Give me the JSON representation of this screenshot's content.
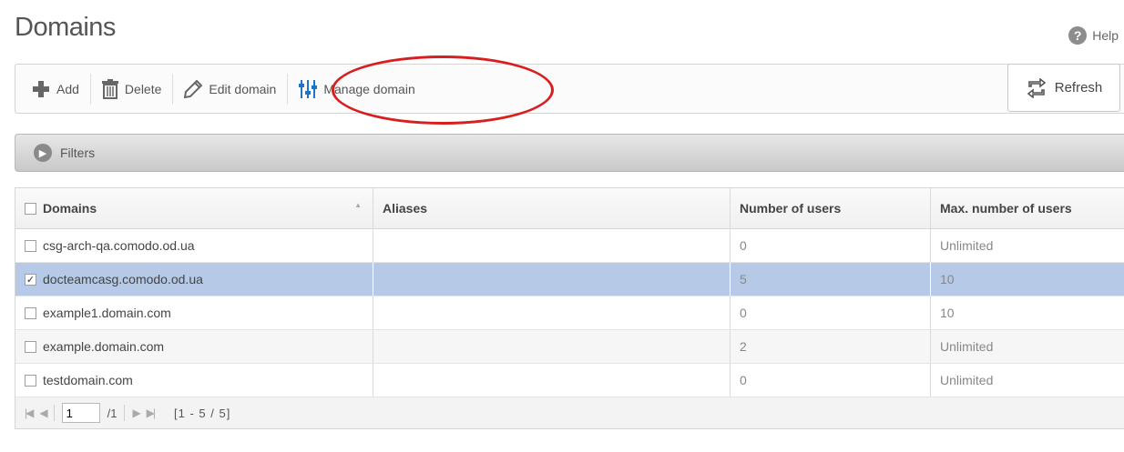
{
  "page": {
    "title": "Domains",
    "help_label": "Help"
  },
  "toolbar": {
    "add_label": "Add",
    "delete_label": "Delete",
    "edit_label": "Edit domain",
    "manage_label": "Manage domain",
    "refresh_label": "Refresh"
  },
  "filters": {
    "label": "Filters"
  },
  "table": {
    "headers": {
      "domains": "Domains",
      "aliases": "Aliases",
      "users": "Number of users",
      "max_users": "Max. number of users"
    },
    "rows": [
      {
        "domain": "csg-arch-qa.comodo.od.ua",
        "aliases": "",
        "users": "0",
        "max": "Unlimited",
        "checked": false
      },
      {
        "domain": "docteamcasg.comodo.od.ua",
        "aliases": "",
        "users": "5",
        "max": "10",
        "checked": true
      },
      {
        "domain": "example1.domain.com",
        "aliases": "",
        "users": "0",
        "max": "10",
        "checked": false
      },
      {
        "domain": "example.domain.com",
        "aliases": "",
        "users": "2",
        "max": "Unlimited",
        "checked": false
      },
      {
        "domain": "testdomain.com",
        "aliases": "",
        "users": "0",
        "max": "Unlimited",
        "checked": false
      }
    ]
  },
  "pager": {
    "page": "1",
    "total_pages": "/1",
    "range": "[1 - 5 / 5]"
  },
  "colors": {
    "selected_row": "#b6c9e6",
    "annotation": "#d81f1f",
    "manage_icon": "#1e73c8"
  },
  "icons": [
    "plus-icon",
    "trash-icon",
    "pencil-icon",
    "sliders-icon",
    "refresh-icon",
    "help-icon",
    "chevron-right-icon"
  ]
}
